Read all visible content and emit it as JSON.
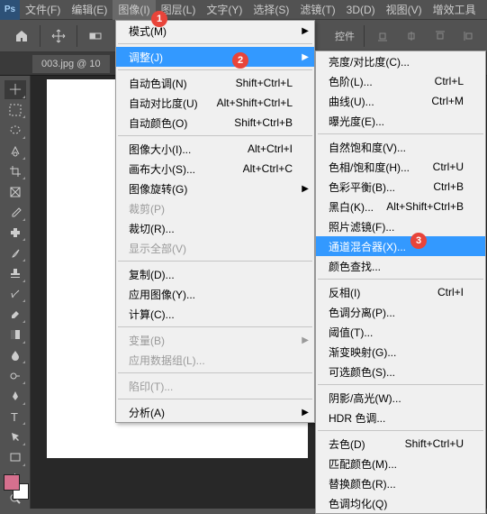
{
  "app": {
    "logo": "Ps"
  },
  "menubar": [
    {
      "label": "文件(F)"
    },
    {
      "label": "编辑(E)"
    },
    {
      "label": "图像(I)",
      "active": true
    },
    {
      "label": "图层(L)"
    },
    {
      "label": "文字(Y)"
    },
    {
      "label": "选择(S)"
    },
    {
      "label": "滤镜(T)"
    },
    {
      "label": "3D(D)"
    },
    {
      "label": "视图(V)"
    },
    {
      "label": "增效工具"
    }
  ],
  "toolbar": {
    "mode_label": "控件"
  },
  "tabs": {
    "doc": "003.jpg @ 10"
  },
  "badges": {
    "b1": "1",
    "b2": "2",
    "b3": "3"
  },
  "menu_image": {
    "mode": {
      "label": "模式(M)"
    },
    "adjust_header": {
      "label": "调整(J)"
    },
    "auto_tone": {
      "label": "自动色调(N)",
      "sc": "Shift+Ctrl+L"
    },
    "auto_contrast": {
      "label": "自动对比度(U)",
      "sc": "Alt+Shift+Ctrl+L"
    },
    "auto_color": {
      "label": "自动颜色(O)",
      "sc": "Shift+Ctrl+B"
    },
    "image_size": {
      "label": "图像大小(I)...",
      "sc": "Alt+Ctrl+I"
    },
    "canvas_size": {
      "label": "画布大小(S)...",
      "sc": "Alt+Ctrl+C"
    },
    "image_rotation": {
      "label": "图像旋转(G)"
    },
    "crop": {
      "label": "裁剪(P)"
    },
    "trim": {
      "label": "裁切(R)..."
    },
    "reveal_all": {
      "label": "显示全部(V)"
    },
    "duplicate": {
      "label": "复制(D)..."
    },
    "apply_image": {
      "label": "应用图像(Y)..."
    },
    "calculations": {
      "label": "计算(C)..."
    },
    "variables": {
      "label": "变量(B)"
    },
    "apply_dataset": {
      "label": "应用数据组(L)..."
    },
    "trap": {
      "label": "陷印(T)..."
    },
    "analysis": {
      "label": "分析(A)"
    }
  },
  "menu_adjust": {
    "brightness": {
      "label": "亮度/对比度(C)..."
    },
    "levels": {
      "label": "色阶(L)...",
      "sc": "Ctrl+L"
    },
    "curves": {
      "label": "曲线(U)...",
      "sc": "Ctrl+M"
    },
    "exposure": {
      "label": "曝光度(E)..."
    },
    "vibrance": {
      "label": "自然饱和度(V)..."
    },
    "hue_sat": {
      "label": "色相/饱和度(H)...",
      "sc": "Ctrl+U"
    },
    "color_balance": {
      "label": "色彩平衡(B)...",
      "sc": "Ctrl+B"
    },
    "black_white": {
      "label": "黑白(K)...",
      "sc": "Alt+Shift+Ctrl+B"
    },
    "photo_filter": {
      "label": "照片滤镜(F)..."
    },
    "channel_mixer": {
      "label": "通道混合器(X)..."
    },
    "color_lookup": {
      "label": "颜色查找..."
    },
    "invert": {
      "label": "反相(I)",
      "sc": "Ctrl+I"
    },
    "posterize": {
      "label": "色调分离(P)..."
    },
    "threshold": {
      "label": "阈值(T)..."
    },
    "gradient_map": {
      "label": "渐变映射(G)..."
    },
    "selective_color": {
      "label": "可选颜色(S)..."
    },
    "shadows_highlights": {
      "label": "阴影/高光(W)..."
    },
    "hdr_toning": {
      "label": "HDR 色调..."
    },
    "desaturate": {
      "label": "去色(D)",
      "sc": "Shift+Ctrl+U"
    },
    "match_color": {
      "label": "匹配颜色(M)..."
    },
    "replace_color": {
      "label": "替换颜色(R)..."
    },
    "equalize": {
      "label": "色调均化(Q)"
    }
  }
}
